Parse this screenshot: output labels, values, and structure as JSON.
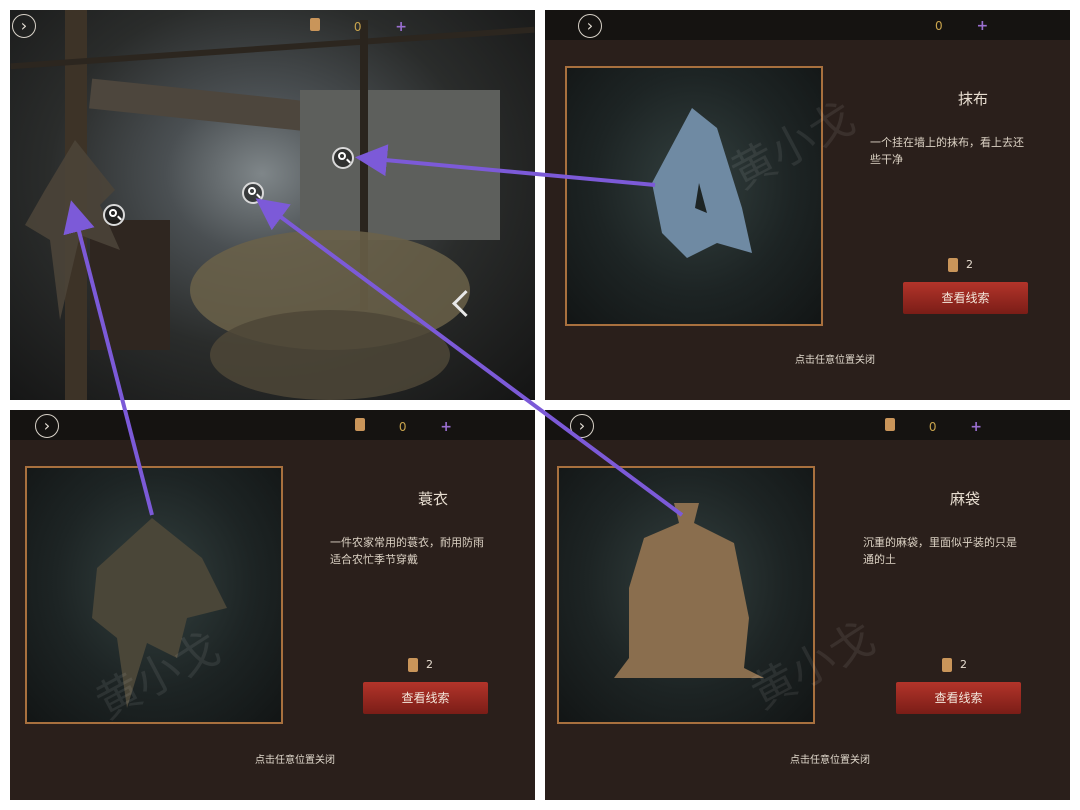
{
  "hud": {
    "currency_count": "0",
    "plus": "+"
  },
  "popups": [
    {
      "title": "抹布",
      "desc": "一个挂在墙上的抹布，看上去还\n些干净",
      "cost": "2",
      "button": "查看线索",
      "close_hint": "点击任意位置关闭"
    },
    {
      "title": "蓑衣",
      "desc": "一件农家常用的蓑衣，耐用防雨\n适合农忙季节穿戴",
      "cost": "2",
      "button": "查看线索",
      "close_hint": "点击任意位置关闭"
    },
    {
      "title": "麻袋",
      "desc": "沉重的麻袋，里面似乎装的只是\n通的土",
      "cost": "2",
      "button": "查看线索",
      "close_hint": "点击任意位置关闭"
    }
  ],
  "watermark": "黄小戈",
  "colors": {
    "arrow": "#7c5ad8",
    "button": "#9a2a22",
    "frame": "#a8703e"
  },
  "icons": {
    "back": "chevron-right-icon",
    "inspect": "magnifier-icon",
    "currency": "scroll-icon"
  }
}
